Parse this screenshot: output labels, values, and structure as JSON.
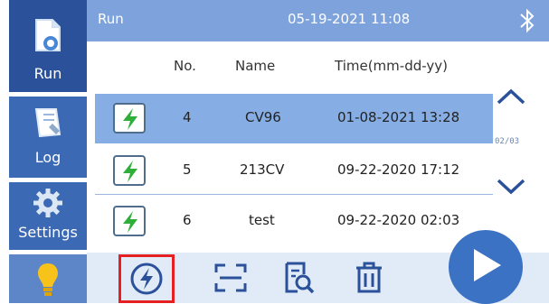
{
  "sidebar": {
    "items": [
      {
        "label": "Run",
        "icon": "document-icon",
        "active": true
      },
      {
        "label": "Log",
        "icon": "notebook-icon",
        "active": false
      },
      {
        "label": "Settings",
        "icon": "gear-icon",
        "active": false
      },
      {
        "label": "",
        "icon": "lightbulb-icon",
        "active": false
      }
    ]
  },
  "header": {
    "title": "Run",
    "datetime": "05-19-2021 11:08",
    "icon": "bluetooth-icon"
  },
  "table": {
    "columns": [
      "No.",
      "Name",
      "Time(mm-dd-yy)"
    ],
    "rows": [
      {
        "no": "4",
        "name": "CV96",
        "time": "01-08-2021 13:28",
        "selected": true
      },
      {
        "no": "5",
        "name": "213CV",
        "time": "09-22-2020 17:12",
        "selected": false
      },
      {
        "no": "6",
        "name": "test",
        "time": "09-22-2020 02:03",
        "selected": false
      }
    ]
  },
  "pagination": {
    "page_text": "02/03"
  },
  "toolbar": {
    "buttons": [
      "charge-icon",
      "scan-icon",
      "search-document-icon",
      "trash-icon"
    ],
    "play_icon": "play-icon"
  },
  "colors": {
    "sidebar": "#3c69b4",
    "header": "#7ea3dc",
    "selected_row": "#86aee4",
    "highlight_box": "#e62020",
    "play": "#3c72c4"
  }
}
